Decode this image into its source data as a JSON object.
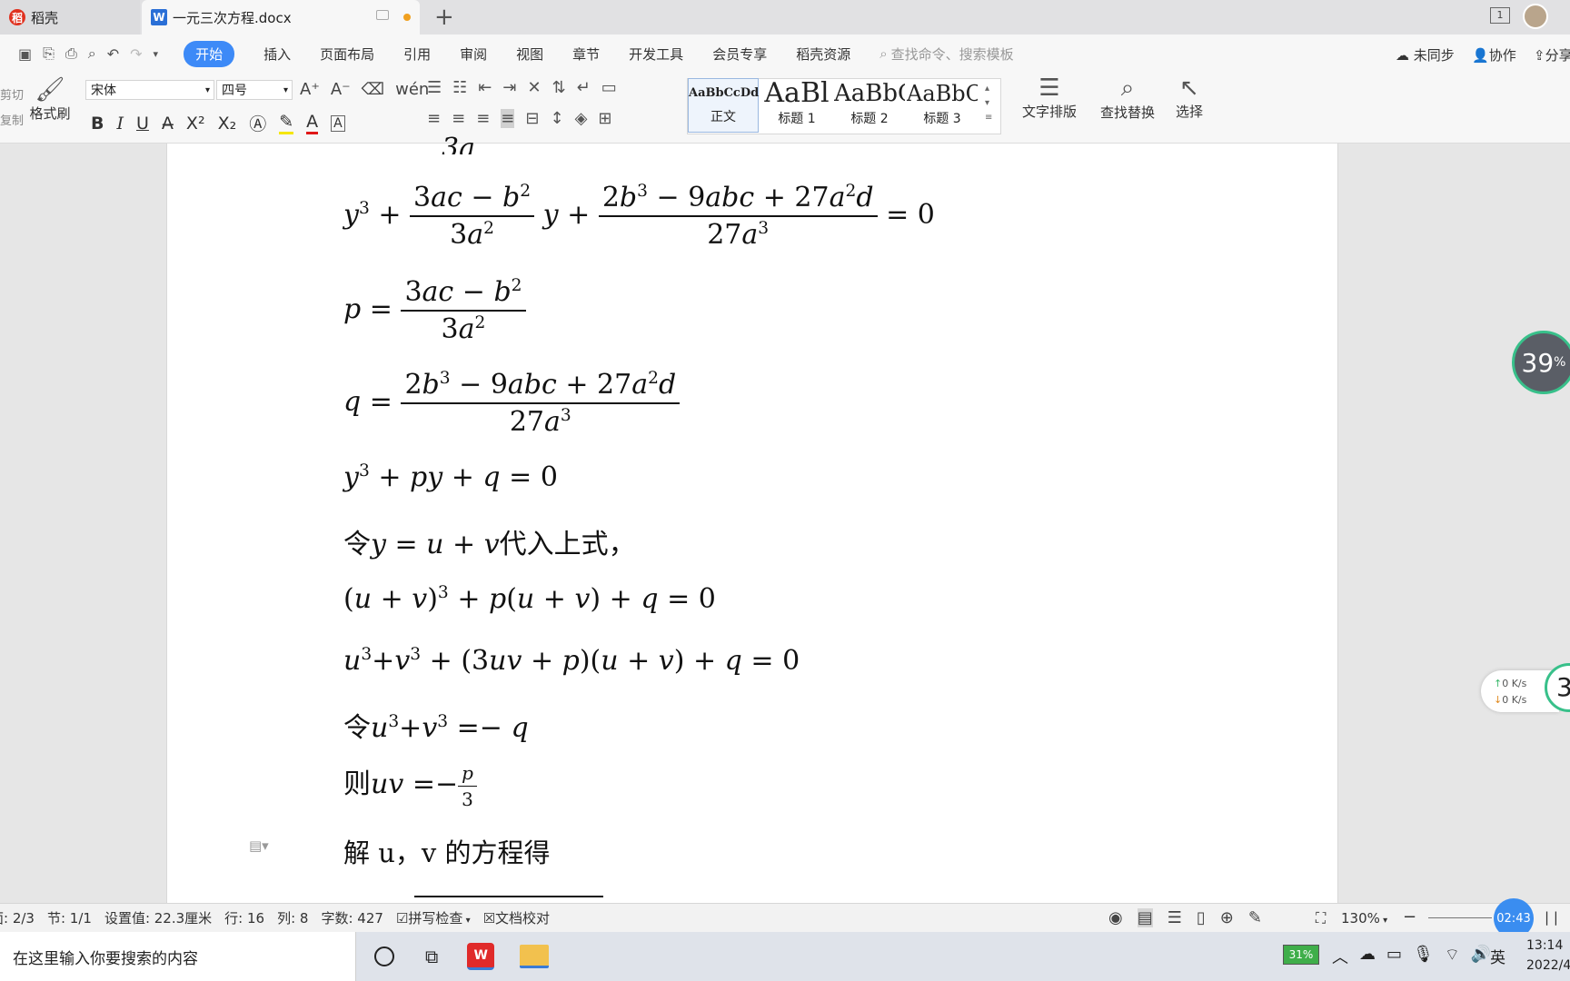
{
  "tabs": [
    {
      "label": "稻壳",
      "logo": "稻"
    },
    {
      "label": "一元三次方程.docx",
      "logo": "W"
    }
  ],
  "new_tab_label": "+",
  "window": {
    "page_badge": "1"
  },
  "menu": {
    "items": [
      "开始",
      "插入",
      "页面布局",
      "引用",
      "审阅",
      "视图",
      "章节",
      "开发工具",
      "会员专享",
      "稻壳资源"
    ],
    "search_placeholder": "查找命令、搜索模板",
    "sync_label": "未同步",
    "collab_label": "协作",
    "share_label": "分享"
  },
  "ribbon": {
    "cut_label": "剪切",
    "copy_label": "复制",
    "format_painter_label": "格式刷",
    "font_name": "宋体",
    "font_size": "四号",
    "styles": [
      {
        "preview": "AaBbCcDd",
        "label": "正文"
      },
      {
        "preview": "AaBl",
        "label": "标题 1"
      },
      {
        "preview": "AaBbC",
        "label": "标题 2"
      },
      {
        "preview": "AaBbC",
        "label": "标题 3"
      }
    ],
    "text_layout_label": "文字排版",
    "find_replace_label": "查找替换",
    "select_label": "选择",
    "bold": "B",
    "italic": "I",
    "underline": "U"
  },
  "document": {
    "partial_top": "3a",
    "line_y3": "y",
    "text_let": "令",
    "text_substitute": "代入上式，",
    "text_then": "则",
    "text_solve": "解 u，v 的方程得"
  },
  "widgets": {
    "cpu_percent": "39",
    "net_up": "0  K/s",
    "net_down": "0  K/s",
    "side_digit": "3"
  },
  "status": {
    "page": "页面: 2/3",
    "section": "节: 1/1",
    "position": "设置值: 22.3厘米",
    "row": "行: 16",
    "col": "列: 8",
    "word_count": "字数: 427",
    "spell_check": "拼写检查",
    "doc_check": "文档校对",
    "zoom": "130%",
    "timer": "02:43"
  },
  "taskbar": {
    "search_placeholder": "在这里输入你要搜索的内容",
    "battery": "31%",
    "ime": "英",
    "time": "13:14",
    "date": "2022/4"
  }
}
